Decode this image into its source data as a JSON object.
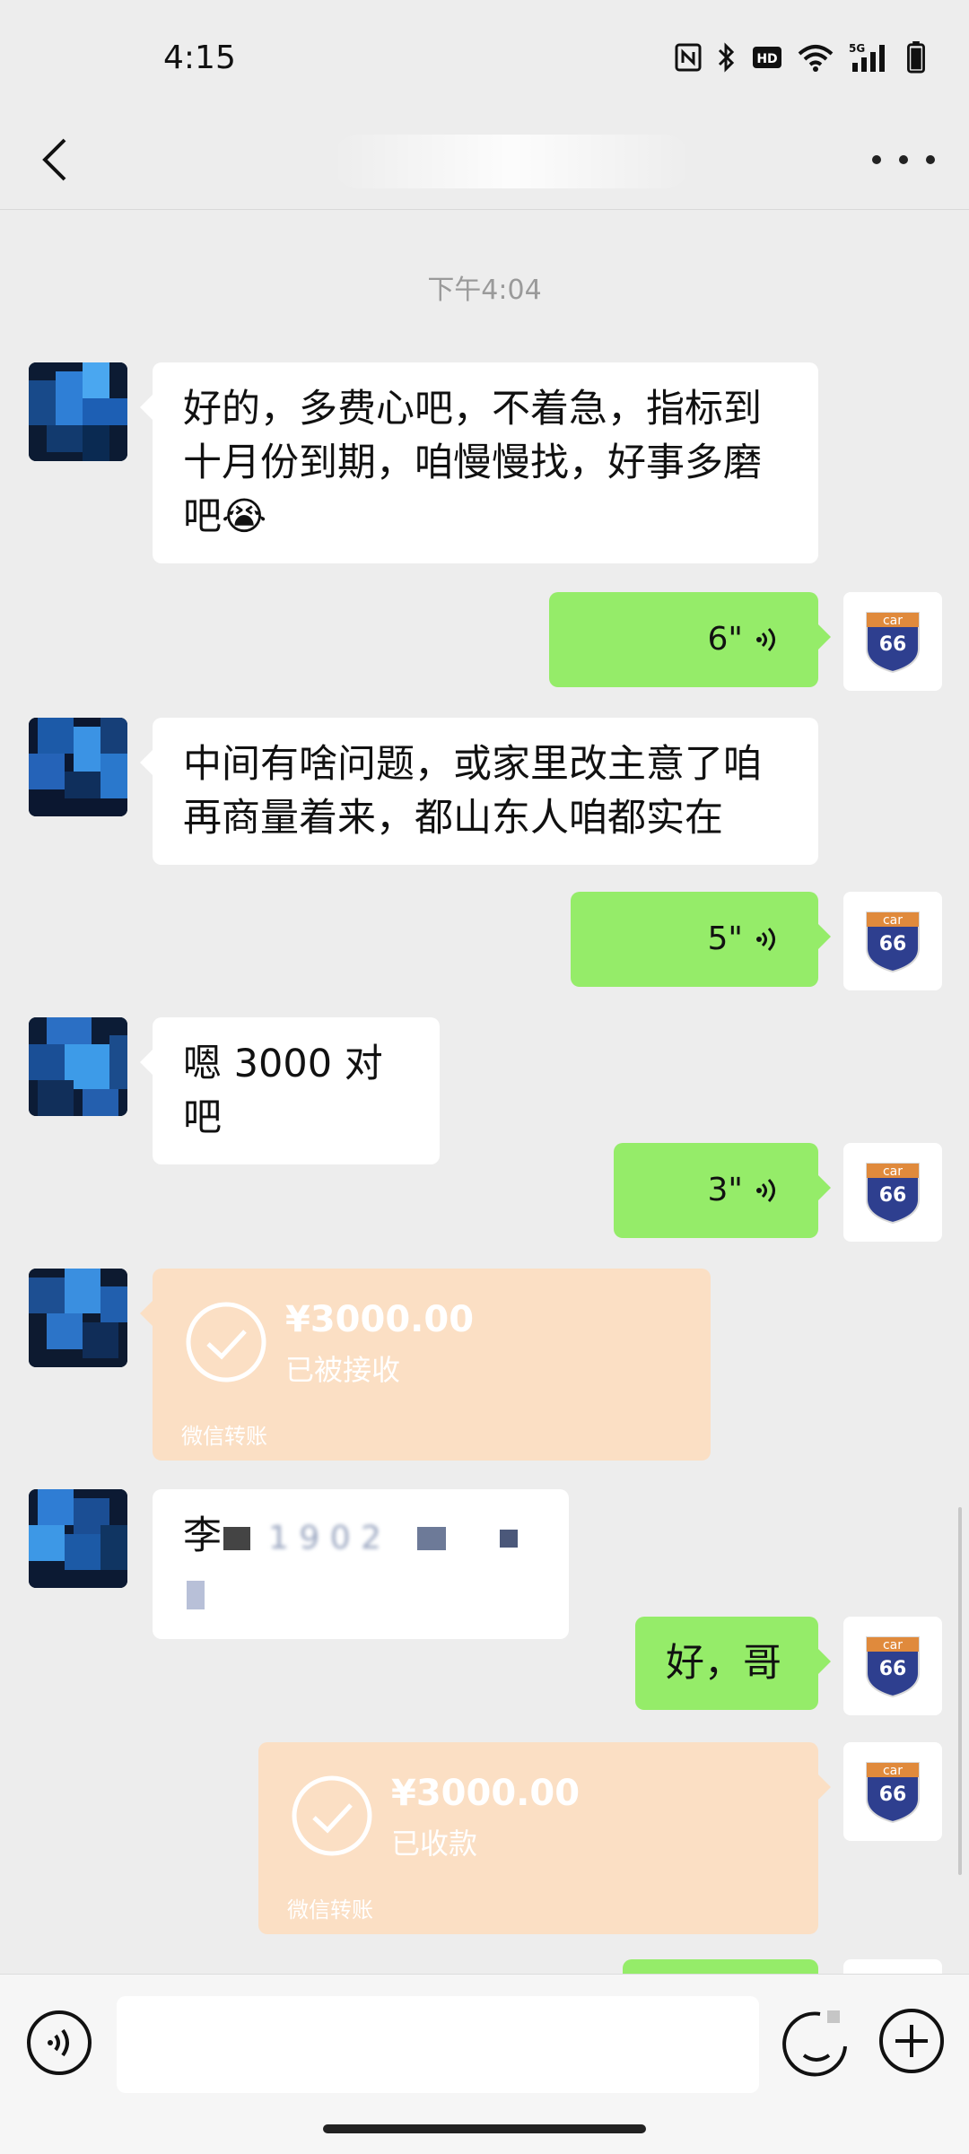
{
  "status_bar": {
    "time": "4:15",
    "icons": [
      "nfc-icon",
      "bluetooth-icon",
      "hd-icon",
      "wifi-icon",
      "5g-signal-icon",
      "battery-icon"
    ],
    "signal_label": "5G",
    "hd_label": "HD"
  },
  "nav": {
    "back_icon": "chevron-left-icon",
    "more_icon": "more-dots-icon"
  },
  "chat": {
    "timestamp": "下午4:04",
    "messages": [
      {
        "side": "left",
        "type": "text",
        "text": "好的，多费心吧，不着急，指标到十月份到期，咱慢慢找，好事多磨吧",
        "emoji": "😭"
      },
      {
        "side": "right",
        "type": "voice",
        "duration": "6\""
      },
      {
        "side": "left",
        "type": "text",
        "text": "中间有啥问题，或家里改主意了咱再商量着来，都山东人咱都实在"
      },
      {
        "side": "right",
        "type": "voice",
        "duration": "5\""
      },
      {
        "side": "left",
        "type": "text",
        "text": "嗯 3000 对吧"
      },
      {
        "side": "right",
        "type": "voice",
        "duration": "3\""
      },
      {
        "side": "left",
        "type": "transfer",
        "amount": "¥3000.00",
        "status": "已被接收",
        "footer": "微信转账"
      },
      {
        "side": "left",
        "type": "text",
        "text": "李",
        "blurred_tail": "1 9 0 2"
      },
      {
        "side": "right",
        "type": "text",
        "text": "好，哥"
      },
      {
        "side": "right",
        "type": "transfer",
        "amount": "¥3000.00",
        "status": "已收款",
        "footer": "微信转账"
      }
    ]
  },
  "colors": {
    "background": "#ededed",
    "bubble_green": "#95ec69",
    "bubble_white": "#ffffff",
    "transfer_bg": "#fbdfc4",
    "timestamp": "#9a9a9a"
  },
  "avatar_right_label": "car",
  "avatar_right_number": "66",
  "input_bar": {
    "voice_icon": "voice-toggle-icon",
    "emoji_icon": "emoji-icon",
    "plus_icon": "plus-circle-icon",
    "placeholder": ""
  }
}
